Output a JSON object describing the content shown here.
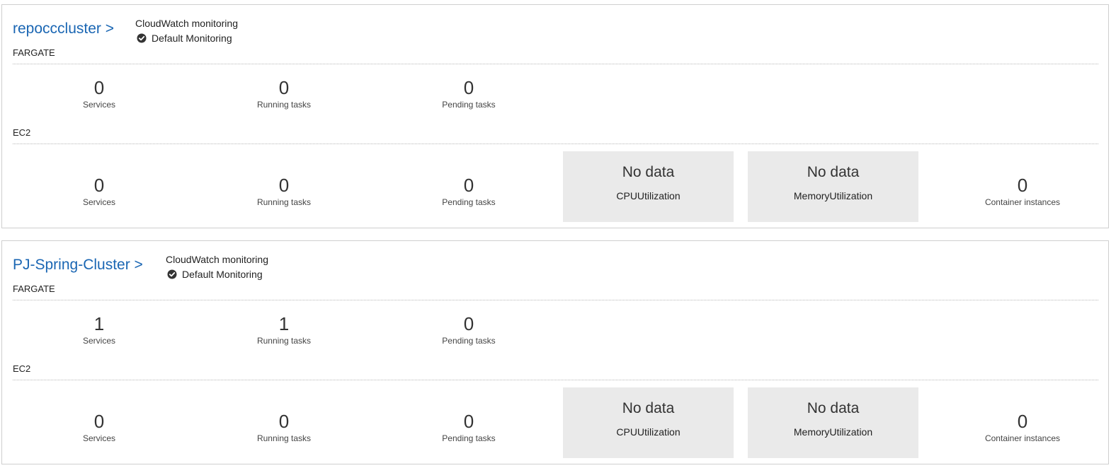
{
  "clusters": [
    {
      "name": "repocccluster >",
      "cloudwatch": {
        "label": "CloudWatch monitoring",
        "status": "Default Monitoring"
      },
      "fargate": {
        "section_label": "FARGATE",
        "services": "0",
        "running_tasks": "0",
        "pending_tasks": "0"
      },
      "ec2": {
        "section_label": "EC2",
        "services": "0",
        "running_tasks": "0",
        "pending_tasks": "0",
        "cpu": {
          "value": "No data",
          "label": "CPUUtilization"
        },
        "memory": {
          "value": "No data",
          "label": "MemoryUtilization"
        },
        "container_instances": "0"
      }
    },
    {
      "name": "PJ-Spring-Cluster >",
      "cloudwatch": {
        "label": "CloudWatch monitoring",
        "status": "Default Monitoring"
      },
      "fargate": {
        "section_label": "FARGATE",
        "services": "1",
        "running_tasks": "1",
        "pending_tasks": "0"
      },
      "ec2": {
        "section_label": "EC2",
        "services": "0",
        "running_tasks": "0",
        "pending_tasks": "0",
        "cpu": {
          "value": "No data",
          "label": "CPUUtilization"
        },
        "memory": {
          "value": "No data",
          "label": "MemoryUtilization"
        },
        "container_instances": "0"
      }
    }
  ],
  "captions": {
    "services": "Services",
    "running_tasks": "Running tasks",
    "pending_tasks": "Pending tasks",
    "container_instances": "Container instances"
  },
  "icons": {
    "monitoring_status": "check-circle-icon"
  },
  "colors": {
    "link": "#1a66b3",
    "nodata_bg": "#eaeaea"
  }
}
